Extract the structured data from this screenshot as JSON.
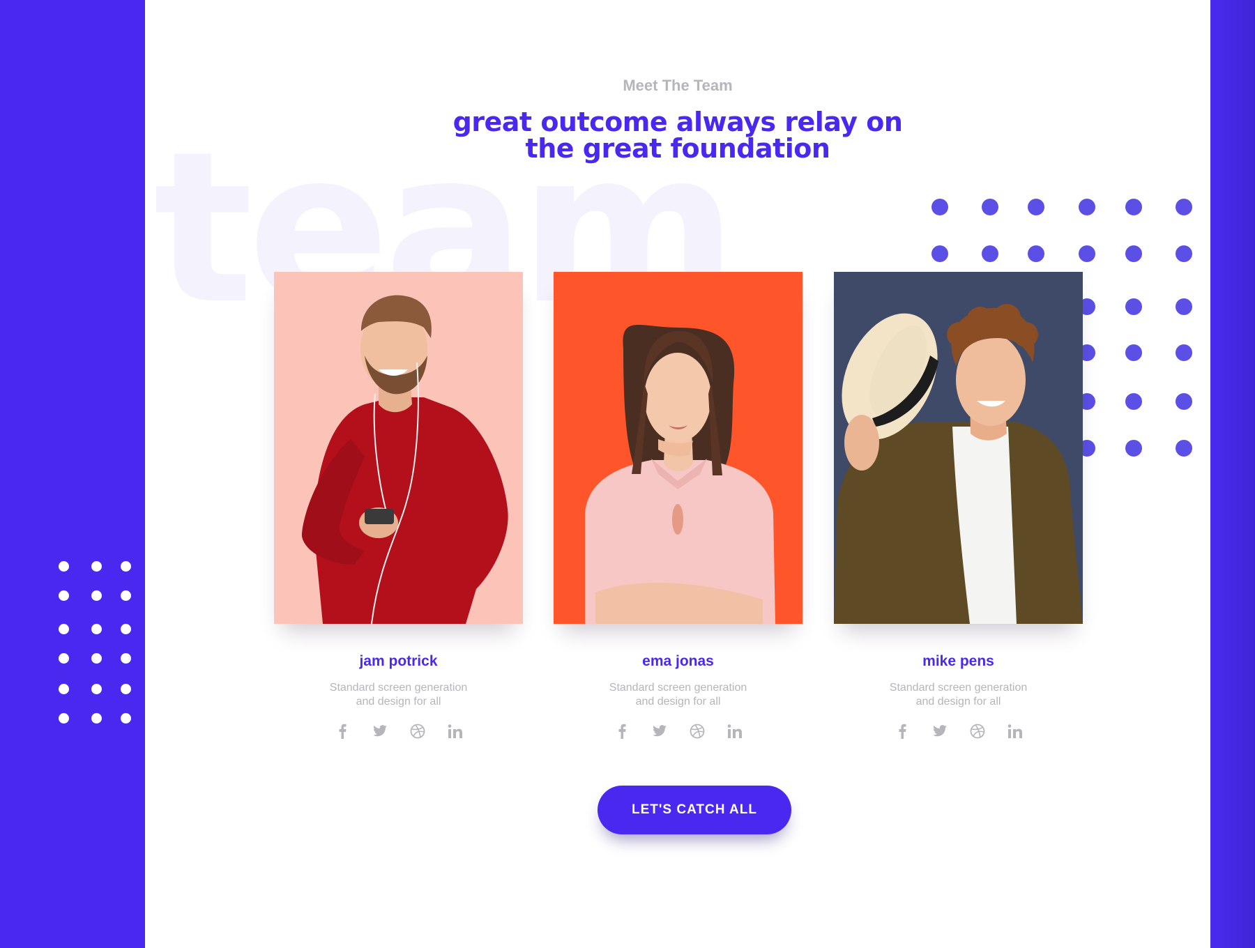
{
  "section": {
    "eyebrow": "Meet The Team",
    "headline_line1": "great outcome always relay on",
    "headline_line2": "the great foundation",
    "watermark": "team"
  },
  "team": [
    {
      "name": "jam potrick",
      "description_line1": "Standard screen generation",
      "description_line2": "and design for all",
      "photo_background": "#fcc3b8"
    },
    {
      "name": "ema jonas",
      "description_line1": "Standard screen generation",
      "description_line2": "and design for all",
      "photo_background": "#ff552a"
    },
    {
      "name": "mike pens",
      "description_line1": "Standard screen generation",
      "description_line2": "and design for all",
      "photo_background": "#3f4a68"
    }
  ],
  "socials": [
    "facebook-icon",
    "twitter-icon",
    "dribbble-icon",
    "linkedin-icon"
  ],
  "cta": {
    "label": "LET'S CATCH ALL"
  },
  "colors": {
    "brand": "#4a28f0",
    "muted_text": "#b5b5bb",
    "dot_purple": "#5b4fe6",
    "panel": "#ffffff"
  }
}
